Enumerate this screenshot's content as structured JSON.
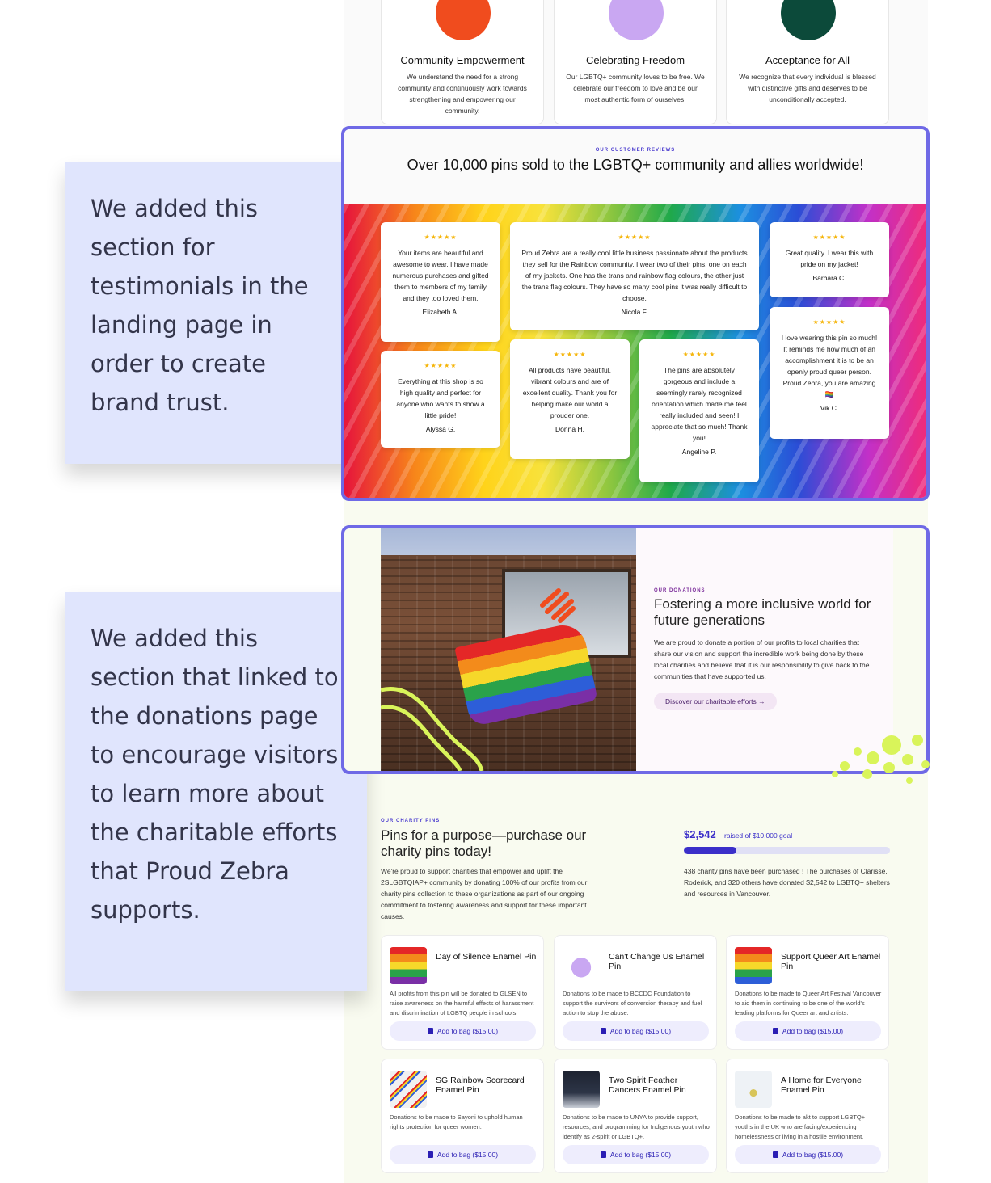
{
  "values": [
    {
      "icon": "hand-raised-icon",
      "color": "#f04c1e",
      "title": "Community Empowerment",
      "text": "We understand the need for a strong community and continuously work towards strengthening and empowering our community."
    },
    {
      "icon": "rainbow-icon",
      "color": "#c9a7f2",
      "title": "Celebrating Freedom",
      "text": "Our LGBTQ+ community loves to be free. We celebrate our freedom to love and be our most authentic form of ourselves."
    },
    {
      "icon": "heart-hands-icon",
      "color": "#0c4a3a",
      "title": "Acceptance for All",
      "text": "We recognize that every individual is blessed with distinctive gifts and deserves to be unconditionally accepted."
    }
  ],
  "notes": {
    "testimonials": "We added this section for testimonials in the landing page in order to create brand trust.",
    "donations": "We added this section that linked to the donations page to encourage visitors to learn more about the charitable efforts that Proud Zebra supports."
  },
  "reviews": {
    "eyebrow": "OUR CUSTOMER REVIEWS",
    "title": "Over 10,000 pins sold to the LGBTQ+ community and allies worldwide!",
    "stars": "★★★★★",
    "items": [
      {
        "text": "Your items are beautiful and awesome to wear. I have made numerous purchases and gifted them to members of my family and they too loved them.",
        "name": "Elizabeth A."
      },
      {
        "text": "Proud Zebra are a really cool little business passionate about the products they sell for the Rainbow community. I wear two of their pins, one on each of my jackets. One has the trans and rainbow flag colours, the other just the trans flag colours. They have so many cool pins it was really difficult to choose.",
        "name": "Nicola F."
      },
      {
        "text": "Great quality. I wear this with pride on my jacket!",
        "name": "Barbara C."
      },
      {
        "text": "Everything at this shop is so high quality and perfect for anyone who wants to show a little pride!",
        "name": "Alyssa G."
      },
      {
        "text": "All products have beautiful, vibrant colours and are of excellent quality. Thank you for helping make our world a prouder one.",
        "name": "Donna H."
      },
      {
        "text": "The pins are absolutely gorgeous and include a seemingly rarely recognized orientation which made me feel really included and seen! I appreciate that so much! Thank you!",
        "name": "Angeline P."
      },
      {
        "text": "I love wearing this pin so much! It reminds me how much of an accomplishment it is to be an openly proud queer person. Proud Zebra, you are amazing 🏳️‍🌈",
        "name": "Vik C."
      }
    ]
  },
  "donations": {
    "eyebrow": "OUR DONATIONS",
    "title": "Fostering a more inclusive world for future generations",
    "text": "We are proud to donate a portion of our profits to local charities that share our vision and support the incredible work being done by these local charities and believe that it is our responsibility to give back to the communities that have supported us.",
    "button": "Discover our charitable efforts →"
  },
  "charity": {
    "eyebrow": "OUR CHARITY PINS",
    "title": "Pins for a purpose—purchase our charity pins today!",
    "text": "We're proud to support charities that empower and uplift the 2SLGBTQIAP+ community by donating 100% of our profits from our charity pins collection to these organizations as part of our ongoing commitment to fostering awareness and support for these important causes.",
    "raised_amount": "$2,542",
    "raised_label": "raised of $10,000 goal",
    "progress": 0.2542,
    "raised_text": "438 charity pins have been purchased ! The purchases of Clarisse, Roderick, and 320 others have donated $2,542 to LGBTQ+ shelters and resources in Vancouver.",
    "pins": [
      {
        "name": "Day of Silence Enamel Pin",
        "desc": "All profits from this pin will be donated to GLSEN to raise awareness on the harmful effects of harassment and discrimination of LGBTQ people in schools.",
        "button": "Add to bag ($15.00)"
      },
      {
        "name": "Can't Change Us Enamel Pin",
        "desc": "Donations to be made to BCCDC Foundation to support the survivors of conversion therapy and fuel action to stop the abuse.",
        "button": "Add to bag ($15.00)"
      },
      {
        "name": "Support Queer Art Enamel Pin",
        "desc": "Donations to be made to Queer Art Festival Vancouver to aid them in continuing to be one of the world's leading platforms for Queer art and artists.",
        "button": "Add to bag ($15.00)"
      },
      {
        "name": "SG Rainbow Scorecard Enamel Pin",
        "desc": "Donations to be made to Sayoni to uphold human rights protection for queer women.",
        "button": "Add to bag ($15.00)"
      },
      {
        "name": "Two Spirit Feather Dancers Enamel Pin",
        "desc": "Donations to be made to UNYA to provide support, resources, and programming for Indigenous youth who identify as 2-spirit or LGBTQ+.",
        "button": "Add to bag ($15.00)"
      },
      {
        "name": "A Home for Everyone Enamel Pin",
        "desc": "Donations to be made to akt to support LGBTQ+ youths in the UK who are facing/experiencing homelessness or living in a hostile environment.",
        "button": "Add to bag ($15.00)"
      }
    ]
  },
  "colors": {
    "frame": "#6f69e6",
    "note_bg": "#e0e5fd",
    "brand_blue": "#3b2fc9"
  }
}
